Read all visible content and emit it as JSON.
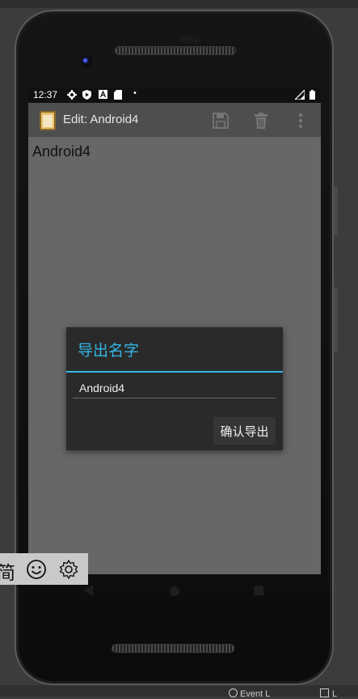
{
  "status_bar": {
    "time": "12:37"
  },
  "action_bar": {
    "title": "Edit: Android4"
  },
  "note": {
    "text": "Android4"
  },
  "dialog": {
    "title": "导出名字",
    "input_value": "Android4",
    "confirm_label": "确认导出"
  },
  "ime_toolbar": {
    "mode_char": "简"
  },
  "bottom_bar": {
    "left_text": "Event L",
    "right_text": "L"
  },
  "colors": {
    "accent": "#33b5e5",
    "dialog_bg": "#2a2a2a",
    "content_bg": "#676767"
  }
}
